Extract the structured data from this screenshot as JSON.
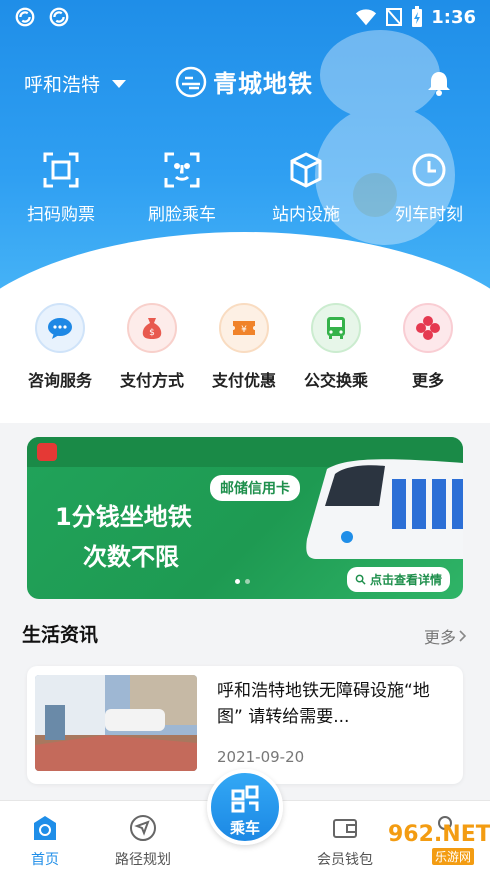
{
  "status": {
    "time": "1:36"
  },
  "header": {
    "city": "呼和浩特",
    "brand": "青城地铁"
  },
  "quick_actions": [
    {
      "label": "扫码购票",
      "icon": "scan-icon"
    },
    {
      "label": "刷脸乘车",
      "icon": "face-icon"
    },
    {
      "label": "站内设施",
      "icon": "facility-icon"
    },
    {
      "label": "列车时刻",
      "icon": "clock-icon"
    }
  ],
  "services": [
    {
      "label": "咨询服务",
      "icon": "chat-icon",
      "color": "#1e88e5"
    },
    {
      "label": "支付方式",
      "icon": "money-bag-icon",
      "color": "#e85a4f"
    },
    {
      "label": "支付优惠",
      "icon": "coupon-icon",
      "color": "#f0832a"
    },
    {
      "label": "公交换乘",
      "icon": "bus-icon",
      "color": "#35b24a"
    },
    {
      "label": "更多",
      "icon": "more-icon",
      "color": "#e53950"
    }
  ],
  "banner": {
    "tag": "邮储信用卡",
    "line1": "1分钱坐地铁",
    "line2": "次数不限",
    "cta": "点击查看详情",
    "page_count": 2,
    "active_page": 0
  },
  "news": {
    "section_title": "生活资讯",
    "more_label": "更多",
    "items": [
      {
        "title": "呼和浩特地铁无障碍设施“地图” 请转给需要...",
        "date": "2021-09-20"
      }
    ]
  },
  "tabbar": {
    "home": "首页",
    "route": "路径规划",
    "ride": "乘车",
    "wallet": "会员钱包"
  },
  "watermark": {
    "text": "962.NET",
    "sub": "乐游网"
  }
}
